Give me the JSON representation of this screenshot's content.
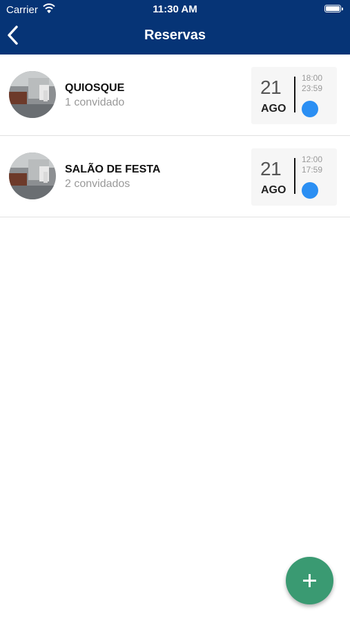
{
  "status_bar": {
    "carrier": "Carrier",
    "time": "11:30 AM"
  },
  "nav": {
    "title": "Reservas",
    "back_icon": "chevron-left-icon"
  },
  "reservations": [
    {
      "name": "QUIOSQUE",
      "guests": "1 convidado",
      "day": "21",
      "month": "AGO",
      "start": "18:00",
      "end": "23:59",
      "status_color": "#2b8ff3"
    },
    {
      "name": "SALÃO DE FESTA",
      "guests": "2 convidados",
      "day": "21",
      "month": "AGO",
      "start": "12:00",
      "end": "17:59",
      "status_color": "#2b8ff3"
    }
  ],
  "fab": {
    "icon": "plus-icon",
    "color": "#3a9a72"
  },
  "colors": {
    "header": "#063476",
    "status_dot": "#2b8ff3",
    "fab": "#3a9a72"
  }
}
